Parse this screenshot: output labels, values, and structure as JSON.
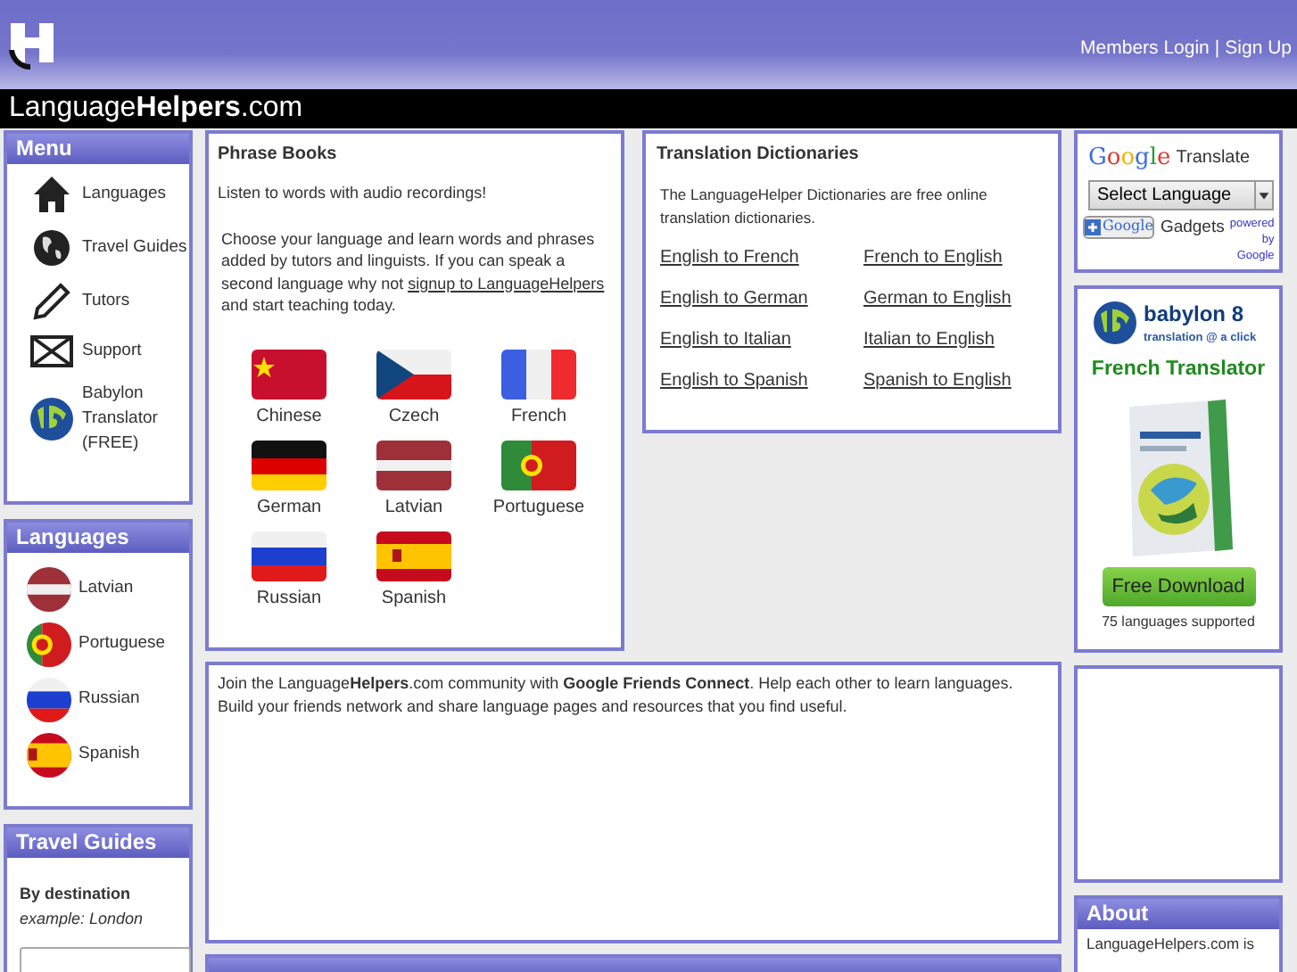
{
  "header": {
    "links": [
      "Members Login",
      "Sign Up"
    ],
    "separator": "|",
    "site_name": "Language**Helpers**.com"
  },
  "menu": {
    "title": "Menu",
    "items": [
      {
        "label": "Languages",
        "kind": "house"
      },
      {
        "label": "Travel Guides",
        "kind": "globe"
      },
      {
        "label": "Tutors",
        "kind": "pencil"
      },
      {
        "label": "Support",
        "kind": "envelope"
      },
      {
        "label": "Babylon Translator (FREE)",
        "kind": "babylon"
      }
    ]
  },
  "languages": {
    "title": "Languages",
    "items": [
      {
        "label": "Latvian",
        "kind": "lv"
      },
      {
        "label": "Portuguese",
        "kind": "pt"
      },
      {
        "label": "Russian",
        "kind": "ru"
      },
      {
        "label": "Spanish",
        "kind": "es"
      }
    ]
  },
  "travel_guides": {
    "title": "Travel Guides",
    "label": "By destination",
    "hint": "example: London"
  },
  "phrase_books": {
    "title": "Phrase Books",
    "intro": "Listen to words with audio recordings!",
    "text_before": "Choose your language and learn words and phrases added by tutors and linguists. If you can speak a second language why not ",
    "link": "signup to LanguageHelpers",
    "text_after": " and start teaching today.",
    "flags": [
      {
        "label": "Chinese",
        "kind": "cn"
      },
      {
        "label": "Czech",
        "kind": "cz"
      },
      {
        "label": "French",
        "kind": "fr"
      },
      {
        "label": "German",
        "kind": "de"
      },
      {
        "label": "Latvian",
        "kind": "lv"
      },
      {
        "label": "Portuguese",
        "kind": "pt"
      },
      {
        "label": "Russian",
        "kind": "ru"
      },
      {
        "label": "Spanish",
        "kind": "es"
      }
    ]
  },
  "dictionaries": {
    "title": "Translation Dictionaries",
    "intro": "The LanguageHelper Dictionaries are free online translation dictionaries.",
    "links": [
      "English to French",
      "French to English",
      "English to German",
      "German to English",
      "English to Italian",
      "Italian to English",
      "English to Spanish",
      "Spanish to English"
    ]
  },
  "community": {
    "text": "Join the Language**Helpers**.com community with **Google Friends Connect**. Help each other to learn languages. Build your friends network and share language pages and resources that you find useful."
  },
  "google_translate": {
    "brand": "Google",
    "title": "Translate",
    "select": "Select Language",
    "button": "Google",
    "gadgets": "Gadgets",
    "powered": "powered by Google"
  },
  "babylon_ad": {
    "name": "babylon 8",
    "tagline": "translation @ a click",
    "heading": "French Translator",
    "button": "Free Download",
    "note": "75 languages supported"
  },
  "about": {
    "title": "About",
    "text": "LanguageHelpers.com is"
  }
}
